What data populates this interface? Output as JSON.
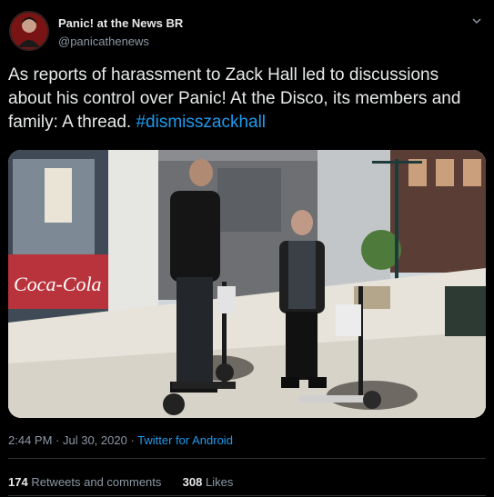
{
  "author": {
    "display_name": "Panic! at the News BR",
    "handle": "@panicathenews"
  },
  "tweet": {
    "text_before": "As reports of harassment to Zack Hall led to discussions about his control over Panic! At the Disco, its members and family: A thread. ",
    "hashtag": "#dismisszackhall"
  },
  "meta": {
    "time": "2:44 PM",
    "separator1": " · ",
    "date": "Jul 30, 2020",
    "separator2": " · ",
    "source": "Twitter for Android"
  },
  "stats": {
    "retweets_count": "174",
    "retweets_label": "Retweets and comments",
    "likes_count": "308",
    "likes_label": "Likes"
  },
  "photo_signage": {
    "storefront_brand": "Coca-Cola"
  },
  "icons": {
    "more": "chevron-down-icon"
  },
  "colors": {
    "background": "#000000",
    "link": "#1d9bf0",
    "muted": "#8b98a5",
    "text": "#e7e9ea"
  }
}
